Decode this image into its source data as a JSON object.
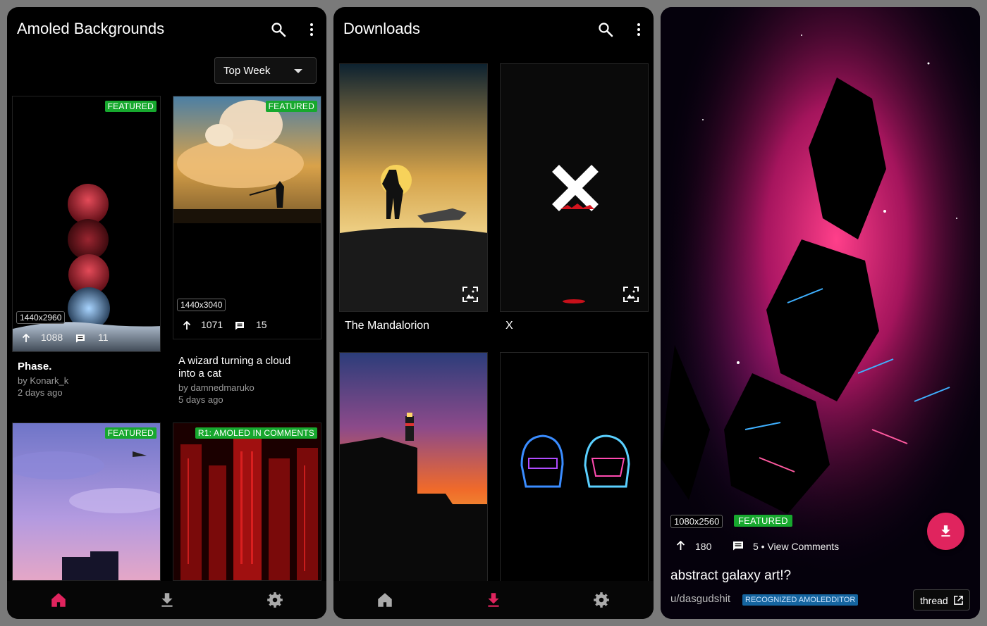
{
  "screen1": {
    "app_title": "Amoled Backgrounds",
    "sort": {
      "selected": "Top Week"
    },
    "posts": [
      {
        "badge": "FEATURED",
        "resolution": "1440x2960",
        "upvotes": "1088",
        "comments": "11",
        "title": "Phase.",
        "author": "by Konark_k",
        "age": "2 days ago"
      },
      {
        "badge": "FEATURED",
        "resolution": "1440x3040",
        "upvotes": "1071",
        "comments": "15",
        "title_line1": "A wizard turning a cloud",
        "title_line2": "into a cat",
        "author": "by damnedmaruko",
        "age": "5 days ago"
      },
      {
        "badge": "FEATURED"
      },
      {
        "badge": "R1: AMOLED IN COMMENTS"
      }
    ],
    "nav_active": "home"
  },
  "screen2": {
    "app_title": "Downloads",
    "downloads": [
      {
        "name": "The Mandalorion"
      },
      {
        "name": "X"
      },
      {
        "name": ""
      },
      {
        "name": ""
      }
    ],
    "nav_active": "downloads"
  },
  "screen3": {
    "resolution": "1080x2560",
    "badge": "FEATURED",
    "upvotes": "180",
    "comments": "5 • View Comments",
    "title": "abstract galaxy art!?",
    "author": "u/dasgudshit",
    "flair": "RECOGNIZED AMOLEDDITOR",
    "thread_label": "thread"
  },
  "colors": {
    "accent": "#e0245e",
    "featured_badge": "#17a82e",
    "flair": "#1565a0",
    "background": "#000000"
  },
  "icons": [
    "search-icon",
    "more-vert-icon",
    "upvote-icon",
    "comment-icon",
    "home-icon",
    "download-icon",
    "settings-icon",
    "set-wallpaper-icon",
    "open-external-icon"
  ]
}
